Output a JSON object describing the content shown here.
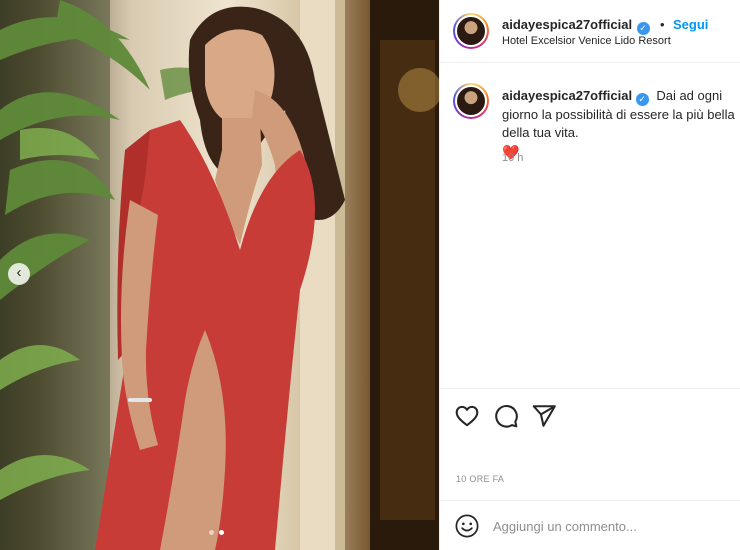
{
  "post": {
    "username": "aidayespica27official",
    "follow_label": "Segui",
    "location": "Hotel Excelsior Venice Lido Resort",
    "carousel_prev_icon": "chevron-left-icon",
    "carousel_dots": 2,
    "carousel_active_index": 1
  },
  "caption": {
    "username": "aidayespica27official",
    "text": "Dai ad ogni giorno la possibilità di essere la più bella della tua vita.",
    "emoji": "❤️",
    "time": "10 h"
  },
  "actions": {
    "icons": [
      "heart-outline-icon",
      "comment-icon",
      "share-icon"
    ],
    "timestamp": "10 ORE FA"
  },
  "add_comment": {
    "placeholder": "Aggiungi un commento...",
    "icon": "emoji-icon"
  },
  "colors": {
    "accent": "#0095f6",
    "verified": "#3897f0",
    "dress_red": "#c83c37",
    "secondary_text": "#8e8e8e"
  }
}
